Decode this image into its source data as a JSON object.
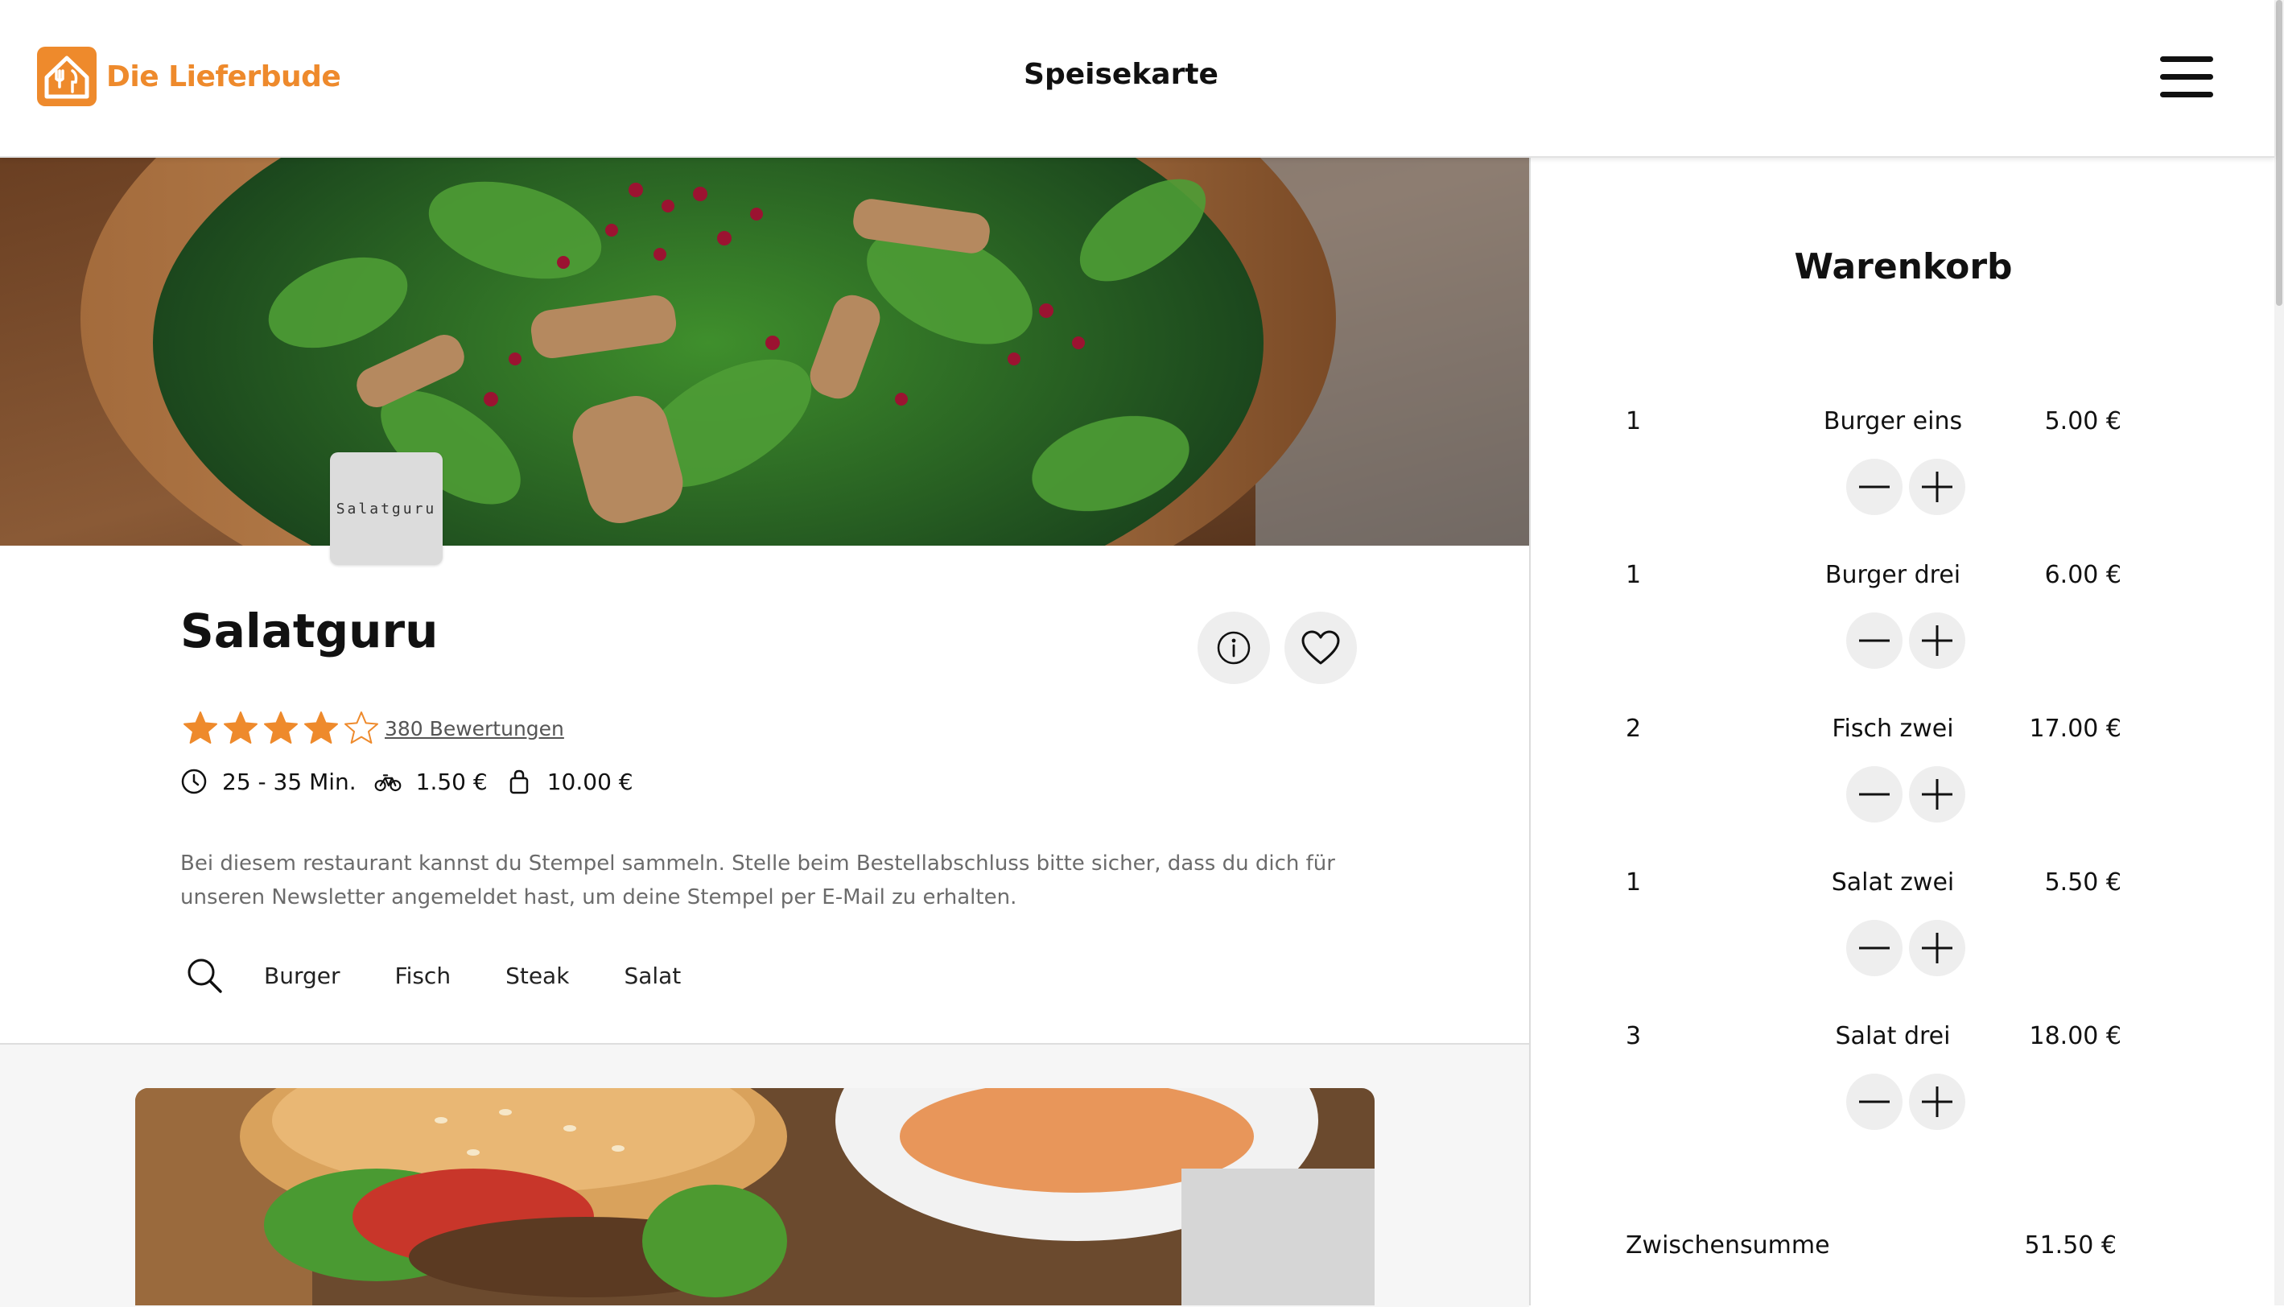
{
  "header": {
    "brand_name": "Die Lieferbude",
    "title": "Speisekarte",
    "brand_color": "#ee8a2c",
    "menu_icon": "hamburger-menu-icon"
  },
  "restaurant": {
    "logo_text": "Salatguru",
    "name": "Salatguru",
    "rating": 4,
    "rating_max": 5,
    "reviews": "380 Bewertungen",
    "delivery_time": "25 - 35 Min.",
    "delivery_fee": "1.50 €",
    "min_order": "10.00 €",
    "description": "Bei diesem restaurant kannst du Stempel sammeln. Stelle beim Bestellabschluss bitte sicher, dass du dich für unseren Newsletter angemeldet hast, um deine Stempel per E-Mail zu erhalten.",
    "icons": [
      "info-icon",
      "heart-icon",
      "clock-icon",
      "bike-icon",
      "bag-icon",
      "search-icon"
    ]
  },
  "categories": [
    "Burger",
    "Fisch",
    "Steak",
    "Salat"
  ],
  "cart": {
    "title": "Warenkorb",
    "items": [
      {
        "qty": "1",
        "name": "Burger eins",
        "price": "5.00 €"
      },
      {
        "qty": "1",
        "name": "Burger drei",
        "price": "6.00 €"
      },
      {
        "qty": "2",
        "name": "Fisch zwei",
        "price": "17.00 €"
      },
      {
        "qty": "1",
        "name": "Salat zwei",
        "price": "5.50 €"
      },
      {
        "qty": "3",
        "name": "Salat drei",
        "price": "18.00 €"
      }
    ],
    "subtotal_label": "Zwischensumme",
    "subtotal_value": "51.50 €"
  }
}
